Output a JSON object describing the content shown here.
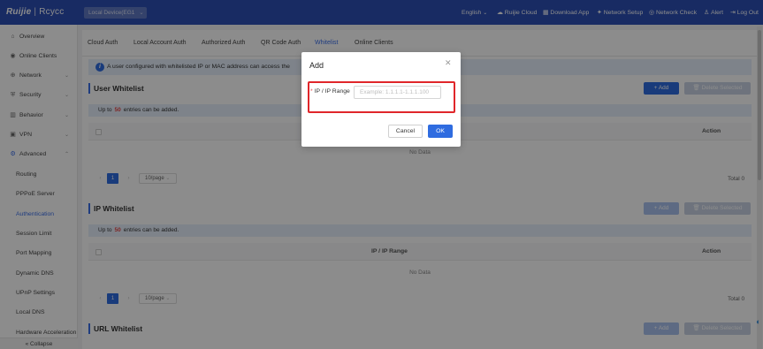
{
  "topbar": {
    "brand": "Ruijie",
    "brand_sub": "Rcycc",
    "device_select": "Local Device(EG1",
    "items": [
      {
        "label": "English",
        "icon": "chevron-down-icon"
      },
      {
        "label": "Ruijie Cloud",
        "icon": "cloud-icon"
      },
      {
        "label": "Download App",
        "icon": "qr-icon"
      },
      {
        "label": "Network Setup",
        "icon": "setup-icon"
      },
      {
        "label": "Network Check",
        "icon": "check-icon"
      },
      {
        "label": "Alert",
        "icon": "alert-icon"
      },
      {
        "label": "Log Out",
        "icon": "logout-icon"
      }
    ]
  },
  "sidebar": {
    "items": [
      {
        "label": "Overview",
        "icon": "overview-icon"
      },
      {
        "label": "Online Clients",
        "icon": "clients-icon"
      },
      {
        "label": "Network",
        "icon": "network-icon"
      },
      {
        "label": "Security",
        "icon": "security-icon"
      },
      {
        "label": "Behavior",
        "icon": "behavior-icon"
      },
      {
        "label": "VPN",
        "icon": "vpn-icon"
      },
      {
        "label": "Advanced",
        "icon": "advanced-icon"
      }
    ],
    "sub_items": [
      {
        "label": "Routing"
      },
      {
        "label": "PPPoE Server"
      },
      {
        "label": "Authentication",
        "active": true
      },
      {
        "label": "Session Limit"
      },
      {
        "label": "Port Mapping"
      },
      {
        "label": "Dynamic DNS"
      },
      {
        "label": "UPnP Settings"
      },
      {
        "label": "Local DNS"
      },
      {
        "label": "Hardware Acceleration"
      }
    ],
    "collapse_label": "« Collapse"
  },
  "main": {
    "tabs": [
      {
        "label": "Cloud Auth"
      },
      {
        "label": "Local Account Auth"
      },
      {
        "label": "Authorized Auth"
      },
      {
        "label": "QR Code Auth"
      },
      {
        "label": "Whitelist",
        "active": true
      },
      {
        "label": "Online Clients"
      }
    ],
    "notice": "A user configured with whitelisted IP or MAC address can access the",
    "sections": [
      {
        "title": "User Whitelist",
        "add_label": "+ Add",
        "delete_label": "Delete Selected",
        "limit_prefix": "Up to",
        "limit_num": "50",
        "limit_suffix": "entries can be added.",
        "column": "",
        "action_label": "Action",
        "nodata": "No Data",
        "page": "1",
        "page_size": "10/page",
        "total": "Total 0"
      },
      {
        "title": "IP Whitelist",
        "add_label": "+ Add",
        "delete_label": "Delete Selected",
        "limit_prefix": "Up to",
        "limit_num": "50",
        "limit_suffix": "entries can be added.",
        "column": "IP / IP Range",
        "action_label": "Action",
        "nodata": "No Data",
        "page": "1",
        "page_size": "10/page",
        "total": "Total 0"
      },
      {
        "title": "URL Whitelist",
        "add_label": "+ Add",
        "delete_label": "Delete Selected"
      }
    ]
  },
  "modal": {
    "title": "Add",
    "field_label": "IP / IP Range",
    "field_required": "*",
    "field_placeholder": "Example: 1.1.1.1-1.1.1.100",
    "field_value": "",
    "cancel_label": "Cancel",
    "ok_label": "OK"
  },
  "colors": {
    "topbar": "#2d4fb5",
    "accent": "#2f6ce0",
    "highlight_frame": "#e0262a"
  }
}
